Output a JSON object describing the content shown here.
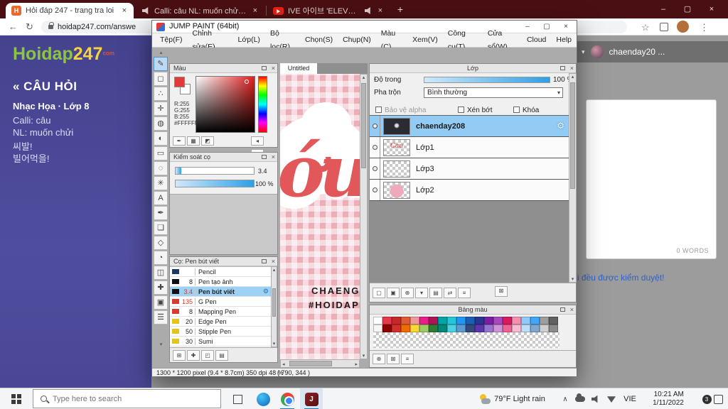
{
  "browser": {
    "controls": {
      "min": "–",
      "max": "▢",
      "close": "×"
    },
    "icons": {
      "favicon_h": "H",
      "back": "←",
      "reload": "↻",
      "star": "☆",
      "menu": "⋮",
      "new_tab": "+"
    },
    "tabs": [
      {
        "title": "Hỏi đáp 247 - trang tra loi"
      },
      {
        "title": "Calli: câu NL: muốn chửi 씨발! 빌"
      },
      {
        "title": "IVE 아이브 'ELEVEN' MV - Yo"
      }
    ],
    "url": "hoidap247.com/answe"
  },
  "site": {
    "logo1": "Hoidap",
    "logo2": "247",
    "logo_sub": "com",
    "heading": "« CÂU HỎI",
    "subject": "Nhạc Họa · Lớp 8",
    "line1": "Calli: câu",
    "line2": "NL: muốn chửi",
    "line3": "씨발!",
    "line4": "빌어먹을!",
    "user_caret": "▾",
    "username": "chaenday20 ...",
    "word_count": "0 WORDS",
    "note": "ời đều được kiểm duyệt!"
  },
  "paint": {
    "title": "JUMP PAINT (64bit)",
    "controls": {
      "min": "–",
      "max": "▢",
      "close": "×"
    },
    "menus": [
      "Tệp(F)",
      "Chỉnh sửa(E)",
      "Lớp(L)",
      "Bộ lọc(R)",
      "Chọn(S)",
      "Chụp(N)",
      "Màu (C)",
      "Xem(V)",
      "Công cụ(T)",
      "Cửa sổ(W)",
      "Cloud",
      "Help"
    ],
    "tools": [
      {
        "name": "brush-tool",
        "glyph": "✎",
        "selected": true
      },
      {
        "name": "eraser-tool",
        "glyph": "◻"
      },
      {
        "name": "dot-tool",
        "glyph": "∴"
      },
      {
        "name": "move-tool",
        "glyph": "✛"
      },
      {
        "name": "fill-tool",
        "glyph": "◍"
      },
      {
        "name": "gradient-tool",
        "glyph": "◐"
      },
      {
        "name": "select-tool",
        "glyph": "▭"
      },
      {
        "name": "lasso-tool",
        "glyph": "◌"
      },
      {
        "name": "magic-wand-tool",
        "glyph": "✳"
      },
      {
        "name": "text-tool",
        "glyph": "A"
      },
      {
        "name": "eyedropper-tool",
        "glyph": "✒"
      },
      {
        "name": "hand-tool",
        "glyph": "❏"
      },
      {
        "name": "shape-tool",
        "glyph": "◇"
      },
      {
        "name": "curve-tool",
        "glyph": "◔"
      },
      {
        "name": "frame-tool",
        "glyph": "◫"
      },
      {
        "name": "add-tool",
        "glyph": "✚"
      },
      {
        "name": "panel-tool",
        "glyph": "▣"
      },
      {
        "name": "menu-tool",
        "glyph": "☰"
      }
    ],
    "color_panel": {
      "title": "Màu",
      "r": "R:255",
      "g": "G:255",
      "b": "B:255",
      "hex": "#FFFFFF"
    },
    "color_buttons": [
      {
        "name": "eyedropper-button",
        "glyph": "✒"
      },
      {
        "name": "palette-grid-button",
        "glyph": "▦"
      },
      {
        "name": "slider-mode-button",
        "glyph": "◩"
      }
    ],
    "color_arrows": [
      {
        "name": "prev-color-button",
        "glyph": "◂"
      },
      {
        "name": "next-color-button",
        "glyph": "▸"
      }
    ],
    "brush_control": {
      "title": "Kiểm soát cọ",
      "size": "3.4",
      "opacity": "100 %"
    },
    "brush_panel": {
      "title": "Cọ: Pen bút viết",
      "brushes": [
        {
          "size": "",
          "name": "Pencil",
          "swatch": "#1b3a63"
        },
        {
          "size": "8",
          "name": "Pen tạo ảnh",
          "swatch": "#101010"
        },
        {
          "size": "3.4",
          "name": "Pen bút viết",
          "swatch": "#101010",
          "selected": true
        },
        {
          "size": "135",
          "name": "G Pen",
          "swatch": "#d63b2f"
        },
        {
          "size": "8",
          "name": "Mapping Pen",
          "swatch": "#d63b2f"
        },
        {
          "size": "20",
          "name": "Edge Pen",
          "swatch": "#e3c41c"
        },
        {
          "size": "50",
          "name": "Stipple Pen",
          "swatch": "#e3c41c"
        },
        {
          "size": "30",
          "name": "Sumi",
          "swatch": "#e3c41c"
        }
      ]
    },
    "brush_buttons": [
      {
        "name": "add-brush-button",
        "glyph": "⊞"
      },
      {
        "name": "edit-brush-button",
        "glyph": "✚"
      },
      {
        "name": "brush-folder-button",
        "glyph": "◰"
      },
      {
        "name": "brush-menu-button",
        "glyph": "▤"
      }
    ],
    "canvas": {
      "doc_tab": "Untitled",
      "script_text": "ớu",
      "caption1": "CHAENG",
      "caption2": "#HOIDAP"
    },
    "layers_panel": {
      "title": "Lớp",
      "opacity_label": "Độ trong",
      "opacity_value": "100 %",
      "blend_label": "Pha trộn",
      "blend_value": "Bình thường",
      "cb_alpha": "Bảo vệ alpha",
      "cb_clip": "Xén bớt",
      "cb_lock": "Khóa",
      "layers": [
        {
          "name": "chaenday208",
          "selected": true
        },
        {
          "name": "Lớp1",
          "thumb_text": "Cau"
        },
        {
          "name": "Lớp3"
        },
        {
          "name": "Lớp2"
        }
      ]
    },
    "layer_buttons": [
      {
        "name": "new-layer-button",
        "glyph": "▢"
      },
      {
        "name": "duplicate-layer-button",
        "glyph": "▣"
      },
      {
        "name": "merge-layer-button",
        "glyph": "⊕"
      },
      {
        "name": "layer-folder-button",
        "glyph": "▾"
      },
      {
        "name": "layer-mask-button",
        "glyph": "▤"
      },
      {
        "name": "transfer-layer-button",
        "glyph": "⇄"
      },
      {
        "name": "layer-order-button",
        "glyph": "≡"
      }
    ],
    "delete_layer_glyph": "⊠",
    "palette_panel": {
      "title": "Bảng màu",
      "rows": [
        [
          "#ffffff",
          "#e8374a",
          "#c62828",
          "#e05a33",
          "#ef9a9a",
          "#e91e8c",
          "#ad1457",
          "#00a6a6",
          "#26c6da",
          "#2196f3",
          "#1a5fb4",
          "#283593",
          "#7b1fa2",
          "#ab47bc",
          "#d81b60",
          "#f48fb1",
          "#90caf9",
          "#42a5f5",
          "#9e9e9e",
          "#616161"
        ],
        [
          "#f5f5f5",
          "#8e0000",
          "#d32f2f",
          "#ef6c00",
          "#fdd835",
          "#9ccc65",
          "#2e7d32",
          "#00897b",
          "#4dd0e1",
          "#5c9bd1",
          "#34497e",
          "#5e35b1",
          "#9575cd",
          "#ce93d8",
          "#f06292",
          "#f8bbd0",
          "#bbdefb",
          "#7fa8d0",
          "#cfcfcf",
          "#8a8a8a"
        ]
      ]
    },
    "palette_buttons": [
      {
        "name": "add-color-button",
        "glyph": "⊕"
      },
      {
        "name": "delete-color-button",
        "glyph": "⊠"
      },
      {
        "name": "palette-menu-button",
        "glyph": "≡"
      }
    ],
    "status": {
      "info": "1300 * 1200 pixel   (9.4 * 8.7cm)   350 dpi   48 %",
      "coords": "( 790, 344 )"
    }
  },
  "taskbar": {
    "search_placeholder": "Type here to search",
    "weather": "79°F Light rain",
    "lang": "VIE",
    "time": "10:21 AM",
    "date": "1/11/2022",
    "badge": "3"
  }
}
